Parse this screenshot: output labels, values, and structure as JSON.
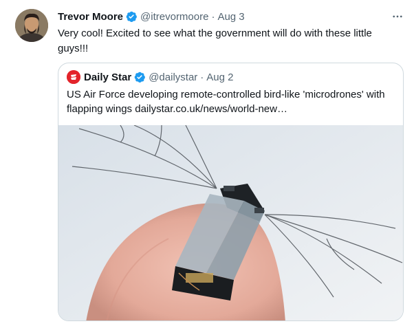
{
  "tweet": {
    "author_name": "Trevor Moore",
    "handle": "@itrevormoore",
    "separator": "·",
    "date": "Aug 3",
    "text": "Very cool! Excited to see what the government will do with these little guys!!!",
    "icons": {
      "verified": "verified-badge-icon",
      "more": "more-options-icon"
    }
  },
  "quoted": {
    "author_name": "Daily Star",
    "logo_text": "Daily Star",
    "handle": "@dailystar",
    "separator": "·",
    "date": "Aug 2",
    "text": "US Air Force developing remote-controlled bird-like 'microdrones' with flapping wings dailystar.co.uk/news/world-new…",
    "media": "photo of a tiny winged robotic microdrone on a fingertip"
  },
  "colors": {
    "verified": "#1d9bf0",
    "muted": "#536471",
    "border": "#cfd9de",
    "daily_star_red": "#e3242b"
  }
}
